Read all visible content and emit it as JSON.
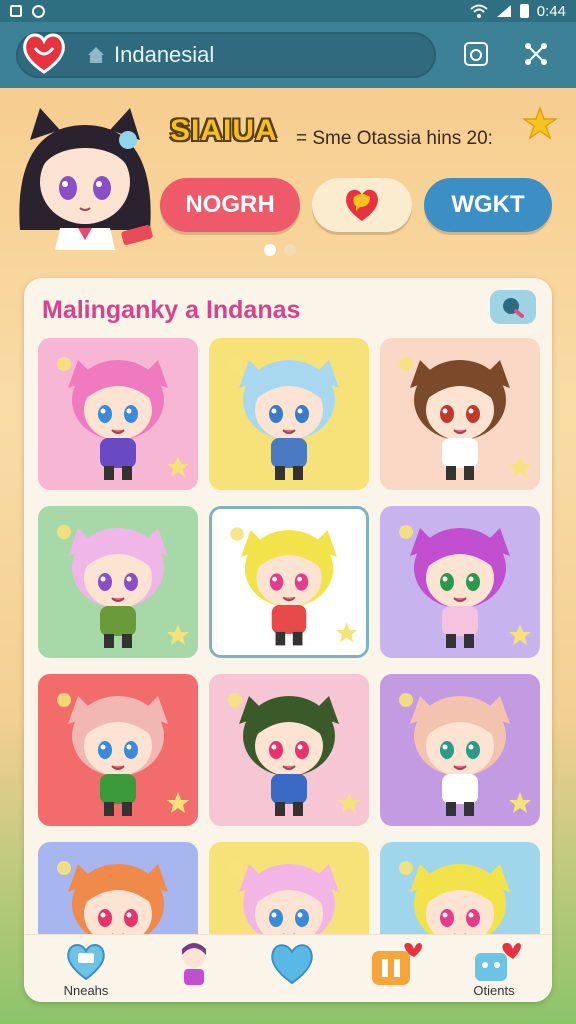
{
  "status_bar": {
    "time": "0:44"
  },
  "top_bar": {
    "search_text": "Indanesial"
  },
  "hero": {
    "title": "SIAIUA",
    "subtitle": "= Sme Otassia hins 20:"
  },
  "buttons": {
    "left_label": "NOGRH",
    "right_label": "WGKT"
  },
  "panel": {
    "title": "Malinganky a Indanas"
  },
  "tiles": [
    {
      "bg": "#f7b6d3",
      "hair": "#f07ac0"
    },
    {
      "bg": "#f7e27a",
      "hair": "#a8d8f0"
    },
    {
      "bg": "#fbd8c6",
      "hair": "#7a4a2a"
    },
    {
      "bg": "#a6d9a7",
      "hair": "#f0b6e8"
    },
    {
      "bg": "#ffffff",
      "hair": "#f3e34a"
    },
    {
      "bg": "#c7b4ef",
      "hair": "#c24fd0"
    },
    {
      "bg": "#f26c6c",
      "hair": "#f2b7b0"
    },
    {
      "bg": "#f7c6d4",
      "hair": "#3a5a2a"
    },
    {
      "bg": "#c29be3",
      "hair": "#f3c3b0"
    },
    {
      "bg": "#a8b6f0",
      "hair": "#f08a4a"
    },
    {
      "bg": "#f7e27a",
      "hair": "#f3b5e6"
    },
    {
      "bg": "#9fd6ec",
      "hair": "#f3e34a"
    }
  ],
  "bottom_nav": {
    "left_label": "Nneahs",
    "right_label": "Otients"
  },
  "colors": {
    "topbar": "#3d8197",
    "accent_red": "#ef5a6a",
    "accent_blue": "#3c8fc4",
    "title_pink": "#d8428a"
  }
}
